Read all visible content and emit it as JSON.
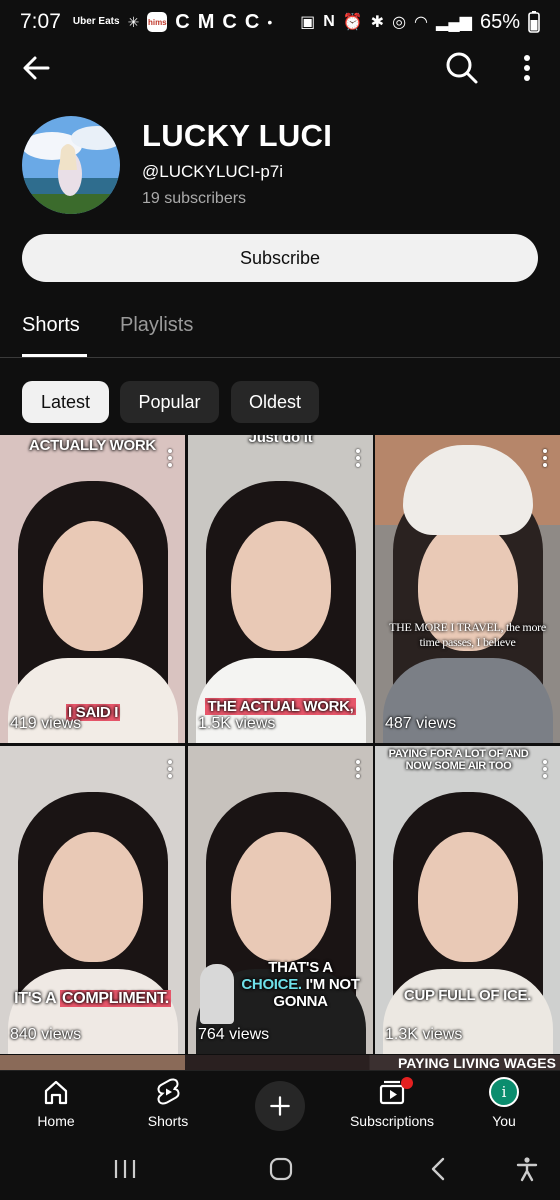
{
  "status_bar": {
    "time": "7:07",
    "battery": "65%",
    "icons": [
      "uber-eats-icon",
      "fan-icon",
      "hims-icon",
      "c-icon",
      "gmail-icon",
      "c-icon",
      "c-icon",
      "dot-icon",
      "lock-icon",
      "nfc-icon",
      "alarm-icon",
      "bluetooth-icon",
      "hotspot-icon",
      "wifi-icon",
      "signal-icon",
      "battery-icon"
    ],
    "uber_label": "Uber Eats",
    "hims_label": "hims"
  },
  "channel": {
    "name": "LUCKY LUCI",
    "handle": "@LUCKYLUCI-p7i",
    "subscribers": "19 subscribers",
    "subscribe_label": "Subscribe"
  },
  "tabs": [
    {
      "label": "Shorts",
      "active": true
    },
    {
      "label": "Playlists",
      "active": false
    }
  ],
  "chips": [
    {
      "label": "Latest",
      "active": true
    },
    {
      "label": "Popular",
      "active": false
    },
    {
      "label": "Oldest",
      "active": false
    }
  ],
  "shorts": [
    {
      "top_caption": "ACTUALLY WORK",
      "bottom_caption": "I SAID I",
      "views": "419 views"
    },
    {
      "top_caption": "Just do it",
      "bottom_caption": "THE ACTUAL WORK,",
      "views": "1.5K views"
    },
    {
      "top_caption": "",
      "bottom_caption": "THE MORE I TRAVEL, the more time passes, I believe",
      "views": "487 views"
    },
    {
      "top_caption": "",
      "bottom_caption_pre": "IT'S A",
      "bottom_caption_hl": "COMPLIMENT.",
      "views": "840 views"
    },
    {
      "top_caption": "",
      "bottom_caption_line1": "THAT'S A",
      "bottom_caption_hl": "CHOICE.",
      "bottom_caption_post": "I'M NOT GONNA",
      "views": "764 views"
    },
    {
      "top_caption": "PAYING FOR A LOT OF AND NOW SOME AIR TOO",
      "bottom_caption": "CUP FULL OF ICE.",
      "views": "1.3K views"
    }
  ],
  "partial_caption": "PAYING LIVING WAGES",
  "bottom_nav": [
    {
      "label": "Home",
      "icon": "home-icon"
    },
    {
      "label": "Shorts",
      "icon": "shorts-icon"
    },
    {
      "label": "",
      "icon": "plus-icon"
    },
    {
      "label": "Subscriptions",
      "icon": "subscriptions-icon"
    },
    {
      "label": "You",
      "icon": "you-avatar-icon",
      "avatar_letter": "i"
    }
  ],
  "colors": {
    "background": "#0f0f0f",
    "chip_active": "#f1f1f1",
    "chip_inactive": "#272727",
    "notification": "#e52020",
    "you_avatar": "#0b8d6e"
  }
}
